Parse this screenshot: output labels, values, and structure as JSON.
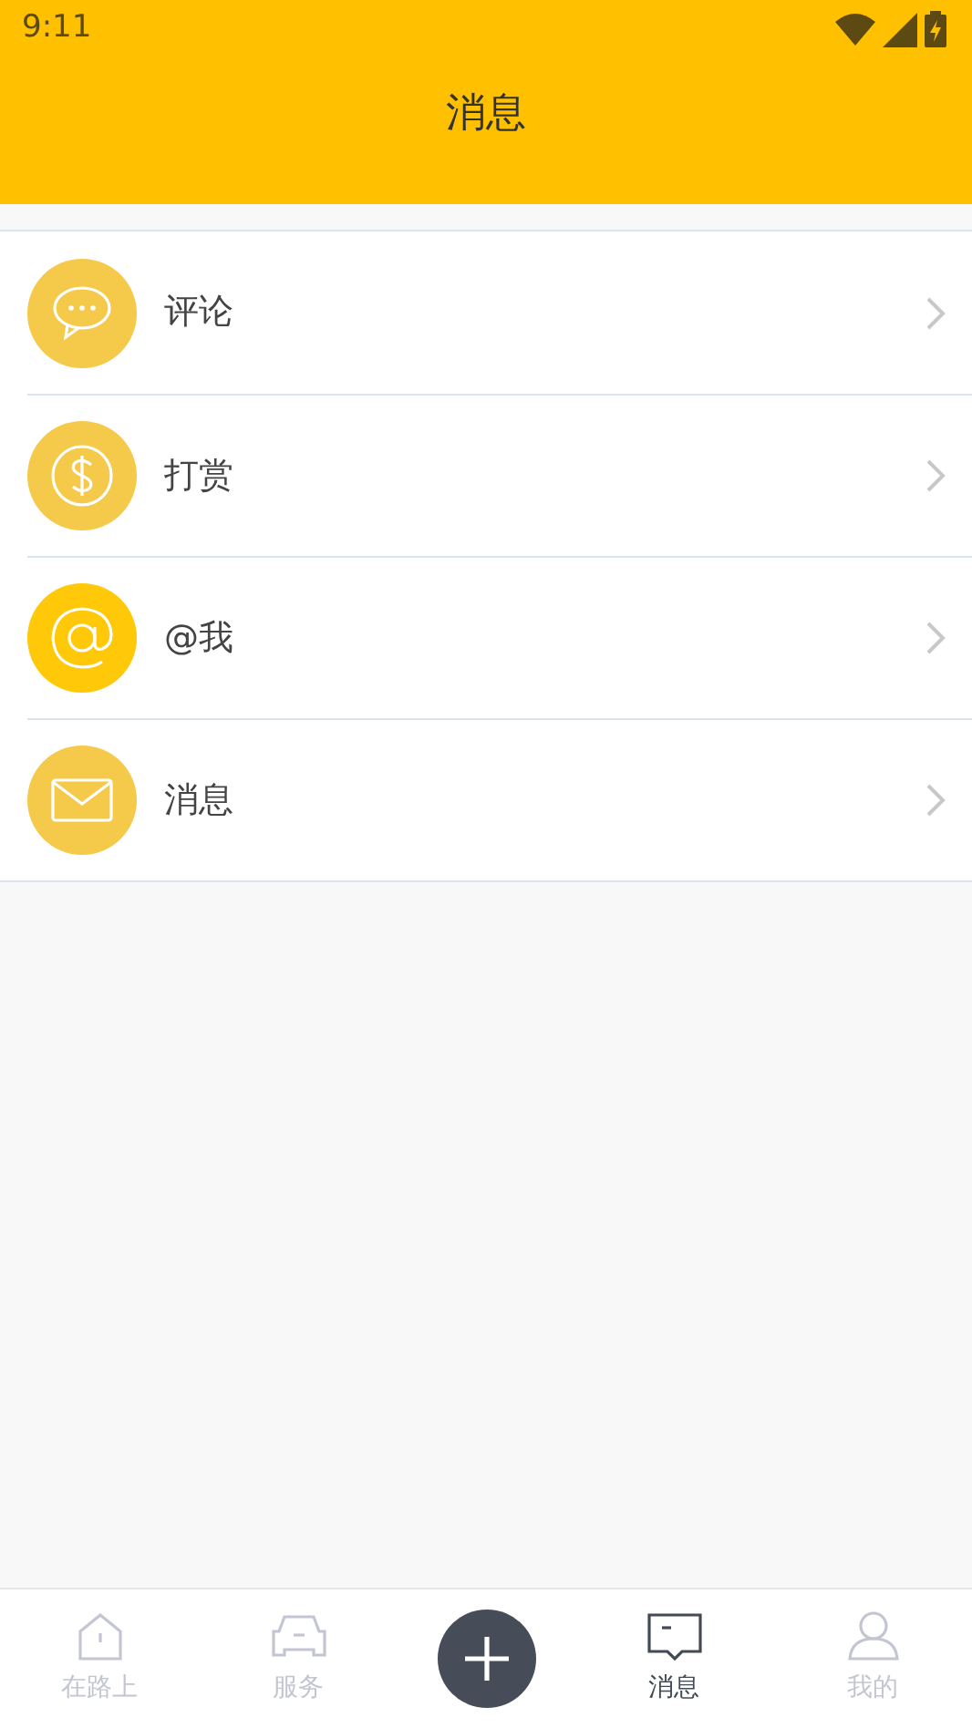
{
  "status_bar": {
    "time": "9:11"
  },
  "header": {
    "title": "消息"
  },
  "items": [
    {
      "label": "评论",
      "color": "#f5ca4b"
    },
    {
      "label": "打赏",
      "color": "#f5ca4b"
    },
    {
      "label": "@我",
      "color": "#ffc808"
    },
    {
      "label": "消息",
      "color": "#f5ca4b"
    }
  ],
  "tab_bar": [
    {
      "kind": "tab",
      "label": "在路上",
      "selected": false
    },
    {
      "kind": "tab",
      "label": "服务",
      "selected": false
    },
    {
      "kind": "add"
    },
    {
      "kind": "tab",
      "label": "消息",
      "selected": true
    },
    {
      "kind": "tab",
      "label": "我的",
      "selected": false
    }
  ]
}
